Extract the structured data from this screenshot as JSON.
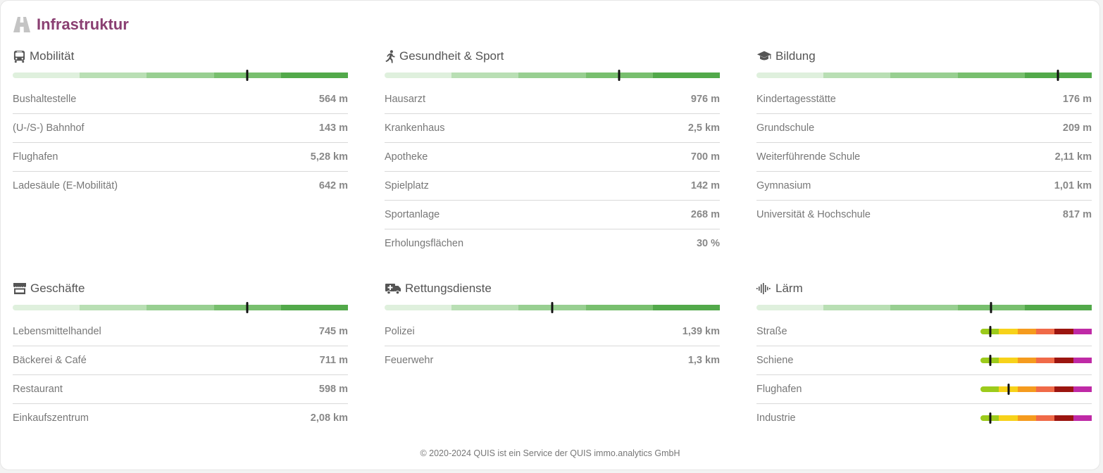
{
  "header": {
    "title": "Infrastruktur",
    "icon": "road-icon",
    "accent": "#8a3f72"
  },
  "scale_colors": [
    "#dff0dd",
    "#b9dfb4",
    "#98cf91",
    "#78bf6e",
    "#52a94a"
  ],
  "noise_colors": [
    "#9ccb1c",
    "#f7d21a",
    "#f59b1e",
    "#f06a48",
    "#9b1510",
    "#bf2aa6"
  ],
  "sections": [
    {
      "id": "mobilitaet",
      "title": "Mobilität",
      "icon": "bus-icon",
      "score": 0.7,
      "rows": [
        {
          "label": "Bushaltestelle",
          "value": "564 m"
        },
        {
          "label": "(U-/S-) Bahnhof",
          "value": "143 m"
        },
        {
          "label": "Flughafen",
          "value": "5,28 km"
        },
        {
          "label": "Ladesäule (E-Mobilität)",
          "value": "642 m"
        }
      ]
    },
    {
      "id": "gesundheit",
      "title": "Gesundheit & Sport",
      "icon": "running-icon",
      "score": 0.7,
      "rows": [
        {
          "label": "Hausarzt",
          "value": "976 m"
        },
        {
          "label": "Krankenhaus",
          "value": "2,5 km"
        },
        {
          "label": "Apotheke",
          "value": "700 m"
        },
        {
          "label": "Spielplatz",
          "value": "142 m"
        },
        {
          "label": "Sportanlage",
          "value": "268 m"
        },
        {
          "label": "Erholungsflächen",
          "value": "30 %"
        }
      ]
    },
    {
      "id": "bildung",
      "title": "Bildung",
      "icon": "graduation-cap-icon",
      "score": 0.9,
      "rows": [
        {
          "label": "Kindertagesstätte",
          "value": "176 m"
        },
        {
          "label": "Grundschule",
          "value": "209 m"
        },
        {
          "label": "Weiterführende Schule",
          "value": "2,11 km"
        },
        {
          "label": "Gymnasium",
          "value": "1,01 km"
        },
        {
          "label": "Universität & Hochschule",
          "value": "817 m"
        }
      ]
    },
    {
      "id": "geschaefte",
      "title": "Geschäfte",
      "icon": "store-icon",
      "score": 0.7,
      "rows": [
        {
          "label": "Lebensmittelhandel",
          "value": "745 m"
        },
        {
          "label": "Bäckerei & Café",
          "value": "711 m"
        },
        {
          "label": "Restaurant",
          "value": "598 m"
        },
        {
          "label": "Einkaufszentrum",
          "value": "2,08 km"
        }
      ]
    },
    {
      "id": "rettung",
      "title": "Rettungsdienste",
      "icon": "ambulance-icon",
      "score": 0.5,
      "rows": [
        {
          "label": "Polizei",
          "value": "1,39 km"
        },
        {
          "label": "Feuerwehr",
          "value": "1,3 km"
        }
      ]
    },
    {
      "id": "laerm",
      "title": "Lärm",
      "icon": "sound-wave-icon",
      "score": 0.7,
      "noise_rows": [
        {
          "label": "Straße",
          "level": 0.09
        },
        {
          "label": "Schiene",
          "level": 0.09
        },
        {
          "label": "Flughafen",
          "level": 0.25
        },
        {
          "label": "Industrie",
          "level": 0.09
        }
      ]
    }
  ],
  "footer": {
    "text": "© 2020-2024 QUIS ist ein Service der QUIS immo.analytics GmbH"
  }
}
